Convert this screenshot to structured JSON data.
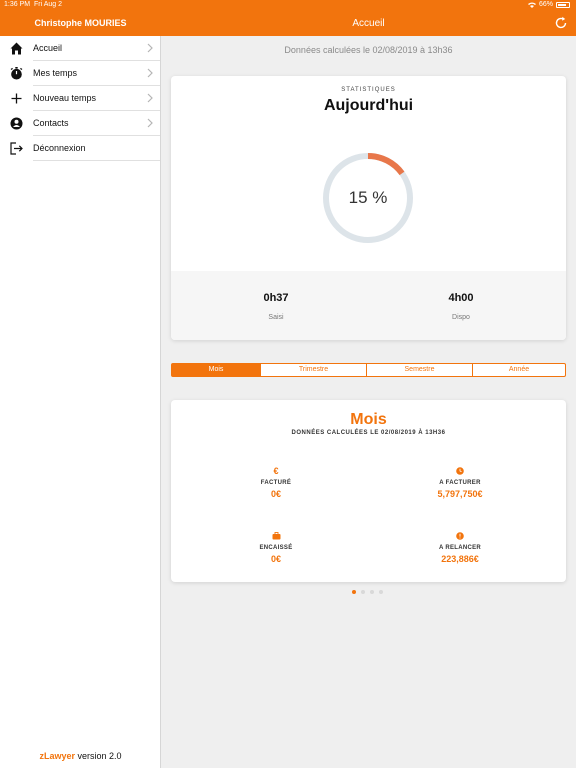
{
  "status_bar": {
    "time": "1:36 PM",
    "date": "Fri Aug 2",
    "battery": "66%"
  },
  "header": {
    "user_name": "Christophe MOURIES",
    "title": "Accueil"
  },
  "sidebar": {
    "items": [
      {
        "label": "Accueil",
        "icon": "home-icon"
      },
      {
        "label": "Mes temps",
        "icon": "stopwatch-icon"
      },
      {
        "label": "Nouveau temps",
        "icon": "plus-icon"
      },
      {
        "label": "Contacts",
        "icon": "contact-icon"
      },
      {
        "label": "Déconnexion",
        "icon": "logout-icon"
      }
    ],
    "version_brand": "zLawyer",
    "version_text": " version 2.0"
  },
  "main": {
    "computed_at": "Données calculées le 02/08/2019 à 13h36",
    "stats": {
      "label": "STATISTIQUES",
      "title": "Aujourd'hui",
      "percent": 15,
      "percent_text": "15 %",
      "saisi_value": "0h37",
      "saisi_label": "Saisi",
      "dispo_value": "4h00",
      "dispo_label": "Dispo"
    },
    "tabs": [
      {
        "label": "Mois",
        "active": true
      },
      {
        "label": "Trimestre",
        "active": false
      },
      {
        "label": "Semestre",
        "active": false
      },
      {
        "label": "Année",
        "active": false
      }
    ],
    "period": {
      "title": "Mois",
      "subtitle": "DONNÉES CALCULÉES LE 02/08/2019 À 13H36",
      "metrics": [
        {
          "icon": "euro-icon",
          "glyph": "€",
          "label": "FACTURÉ",
          "value": "0€"
        },
        {
          "icon": "clock-icon",
          "glyph": "",
          "label": "A FACTURER",
          "value": "5,797,750€"
        },
        {
          "icon": "briefcase-icon",
          "glyph": "",
          "label": "ENCAISSÉ",
          "value": "0€"
        },
        {
          "icon": "alert-icon",
          "glyph": "",
          "label": "A RELANCER",
          "value": "223,886€"
        }
      ]
    },
    "pager": {
      "pages": 4,
      "current": 1
    }
  },
  "colors": {
    "accent": "#f2740d",
    "ring_track": "#dde4e9",
    "ring_fill": "#e8774a"
  }
}
